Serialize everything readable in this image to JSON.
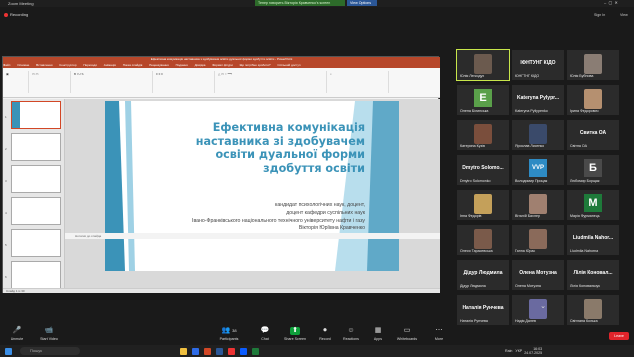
{
  "window": {
    "title": "Zoom Meeting",
    "speaking_banner": "Тепер говорить Вікторія Кравченко's screen",
    "view_options": "View Options",
    "recording": "Recording",
    "sign_in": "Sign In",
    "view": "View"
  },
  "ppt": {
    "title": "Ефективна комунікація наставника з здобувачем освіти дуальної форми здобуття освіти - PowerPoint",
    "tabs": [
      "Файл",
      "Основне",
      "Вставлення",
      "Конструктор",
      "Переходи",
      "Анімація",
      "Показ слайдів",
      "Рецензування",
      "Подання",
      "Довідка",
      "Формат фігури",
      "Що потрібно зробити?",
      "Спільний доступ"
    ],
    "slide_title": "Ефективна комунікація\nнаставника зі здобувачем\nосвіти дуальної форми\nздобуття освіти",
    "slide_subtitle": "кандидат психологічних наук, доцент,\nдоцент кафедри суспільних наук\nІвано-Франківського національного технічного університету нафти і газу\nВікторія Юріївна Кравченко",
    "notes_placeholder": "Нотатки до слайда",
    "status": "Слайд 1 із 30",
    "thumb_numbers": [
      "1",
      "2",
      "3",
      "4",
      "5",
      "6"
    ]
  },
  "participants": [
    {
      "name": "Юлія Легкодух",
      "kind": "photo",
      "color": "#6b5a4e"
    },
    {
      "name": "ЮНГТНГ КІДО",
      "kind": "text",
      "text": "ІФНТУНГ КІДО"
    },
    {
      "name": "Юлія Бубнова",
      "kind": "photo",
      "color": "#8a7d74"
    },
    {
      "name": "Олена Білинська",
      "kind": "letter",
      "letter": "E",
      "color": "#5aa04a"
    },
    {
      "name": "Kateryna Pyliypenko",
      "kind": "text",
      "text": "Kateryna Pylypr..."
    },
    {
      "name": "Ірина Федорович",
      "kind": "photo",
      "color": "#b59070"
    },
    {
      "name": "Катерина Кузів",
      "kind": "photo",
      "color": "#7a4e3c"
    },
    {
      "name": "Ярослав Лисенко",
      "kind": "photo",
      "color": "#3a4a6a"
    },
    {
      "name": "Світна ОА",
      "kind": "text",
      "text": "Свитка ОА"
    },
    {
      "name": "Dmytro Solomonko",
      "kind": "text",
      "text": "Dmytro Solomo..."
    },
    {
      "name": "Володимир Процак",
      "kind": "letter",
      "letter": "VVP",
      "color": "#2e8bc4"
    },
    {
      "name": "Любомир Борщак",
      "kind": "letter",
      "letter": "Б",
      "color": "#4a4a4a"
    },
    {
      "name": "Інна Федорів",
      "kind": "photo",
      "color": "#c4a05a"
    },
    {
      "name": "Віталій Бахлер",
      "kind": "photo",
      "color": "#a08070"
    },
    {
      "name": "Марія Фурманець",
      "kind": "letter",
      "letter": "M",
      "color": "#1e7a3a"
    },
    {
      "name": "Олеся Тарасевська",
      "kind": "photo",
      "color": "#7a5a4a"
    },
    {
      "name": "Ганна Юрас",
      "kind": "photo",
      "color": "#8a6a5a"
    },
    {
      "name": "Liudmila Nahorna",
      "kind": "text",
      "text": "Liudmila Nahor..."
    },
    {
      "name": "Дідур Людмила",
      "kind": "text",
      "text": "Дідур Людмила"
    },
    {
      "name": "Олена Мотузна",
      "kind": "text",
      "text": "Олена Мотузна"
    },
    {
      "name": "Лілія Коновальчук",
      "kind": "text",
      "text": "Лілія Коновал..."
    },
    {
      "name": "Наталія Рунчева",
      "kind": "text",
      "text": "Наталія Рунчева"
    },
    {
      "name": "Надія Далев",
      "kind": "photo",
      "color": "#6a6aa0"
    },
    {
      "name": "Світлана Колька",
      "kind": "photo",
      "color": "#8a7a6a"
    }
  ],
  "toolbar": [
    {
      "label": "Unmute",
      "icon": "🎤"
    },
    {
      "label": "Start Video",
      "icon": "📹"
    },
    {
      "label": "Participants",
      "icon": "👥",
      "count": "38"
    },
    {
      "label": "Chat",
      "icon": "💬"
    },
    {
      "label": "Share Screen",
      "icon": "⬆"
    },
    {
      "label": "Record",
      "icon": "⏺"
    },
    {
      "label": "Reactions",
      "icon": "☺"
    },
    {
      "label": "Apps",
      "icon": "▦"
    },
    {
      "label": "Whiteboards",
      "icon": "▭"
    },
    {
      "label": "More",
      "icon": "⋯"
    }
  ],
  "leave": "Leave",
  "taskbar": {
    "search_placeholder": "Пошук",
    "weather": "Rain",
    "lang": "УКР",
    "time": "16:03",
    "date": "24.07.2025"
  }
}
